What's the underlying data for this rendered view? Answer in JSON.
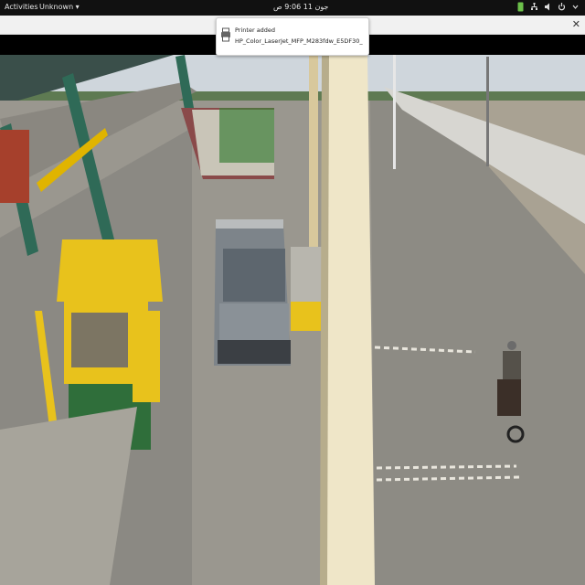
{
  "topbar": {
    "activities": "Activities",
    "app_menu": "Unknown ▾",
    "clock": "جون 11  9:06 ص",
    "tray_icons": [
      "app-indicator-icon",
      "network-icon",
      "volume-icon",
      "power-icon",
      "chevron-down-icon"
    ]
  },
  "notification": {
    "title": "Printer added",
    "body": "HP_Color_LaserJet_MFP_M283fdw_E5DF30_"
  },
  "window": {
    "close_glyph": "✕"
  },
  "colors": {
    "booth_yellow": "#e8c21c",
    "booth_green": "#2f6e3a",
    "canopy_cream": "#efe6c8",
    "asphalt": "#8f8d86"
  }
}
